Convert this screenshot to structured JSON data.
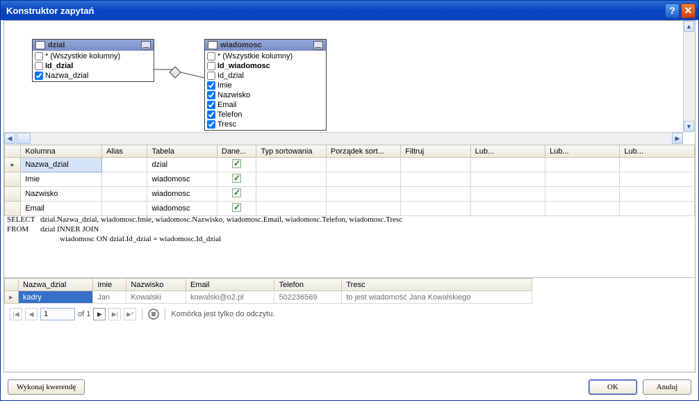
{
  "window": {
    "title": "Konstruktor zapytań"
  },
  "tables": {
    "dzial": {
      "name": "dzial",
      "columns": [
        {
          "label": "* (Wszystkie kolumny)",
          "checked": false,
          "bold": false
        },
        {
          "label": "Id_dzial",
          "checked": false,
          "bold": true
        },
        {
          "label": "Nazwa_dzial",
          "checked": true,
          "bold": false
        }
      ]
    },
    "wiadomosc": {
      "name": "wiadomosc",
      "columns": [
        {
          "label": "* (Wszystkie kolumny)",
          "checked": false,
          "bold": false
        },
        {
          "label": "Id_wiadomosc",
          "checked": false,
          "bold": true
        },
        {
          "label": "Id_dzial",
          "checked": false,
          "bold": false
        },
        {
          "label": "Imie",
          "checked": true,
          "bold": false
        },
        {
          "label": "Nazwisko",
          "checked": true,
          "bold": false
        },
        {
          "label": "Email",
          "checked": true,
          "bold": false
        },
        {
          "label": "Telefon",
          "checked": true,
          "bold": false
        },
        {
          "label": "Tresc",
          "checked": true,
          "bold": false
        }
      ]
    }
  },
  "grid": {
    "headers": [
      "Kolumna",
      "Alias",
      "Tabela",
      "Dane...",
      "Typ sortowania",
      "Porządek sort...",
      "Filtruj",
      "Lub...",
      "Lub...",
      "Lub..."
    ],
    "rows": [
      {
        "col": "Nazwa_dzial",
        "alias": "",
        "tabela": "dzial",
        "dane": true,
        "selected": true
      },
      {
        "col": "Imie",
        "alias": "",
        "tabela": "wiadomosc",
        "dane": true,
        "selected": false
      },
      {
        "col": "Nazwisko",
        "alias": "",
        "tabela": "wiadomosc",
        "dane": true,
        "selected": false
      },
      {
        "col": "Email",
        "alias": "",
        "tabela": "wiadomosc",
        "dane": true,
        "selected": false
      }
    ]
  },
  "sql": {
    "select_kw": "SELECT",
    "select_body": "dzial.Nazwa_dzial, wiadomosc.Imie, wiadomosc.Nazwisko, wiadomosc.Email, wiadomosc.Telefon, wiadomosc.Tresc",
    "from_kw": "FROM",
    "from_body1": "dzial INNER JOIN",
    "from_body2": "wiadomosc ON dzial.Id_dzial = wiadomosc.Id_dzial"
  },
  "results": {
    "headers": [
      "Nazwa_dzial",
      "Imie",
      "Nazwisko",
      "Email",
      "Telefon",
      "Tresc"
    ],
    "rows": [
      {
        "Nazwa_dzial": "kadry",
        "Imie": "Jan",
        "Nazwisko": "Kowalski",
        "Email": "kowalski@o2.pl",
        "Telefon": "502236569",
        "Tresc": "to jest wiadomość Jana Kowalskiego"
      }
    ]
  },
  "nav": {
    "current": "1",
    "of_label": "of 1",
    "status": "Komórka jest tylko do odczytu."
  },
  "footer": {
    "execute": "Wykonaj kwerendę",
    "ok": "OK",
    "cancel": "Anuluj"
  }
}
